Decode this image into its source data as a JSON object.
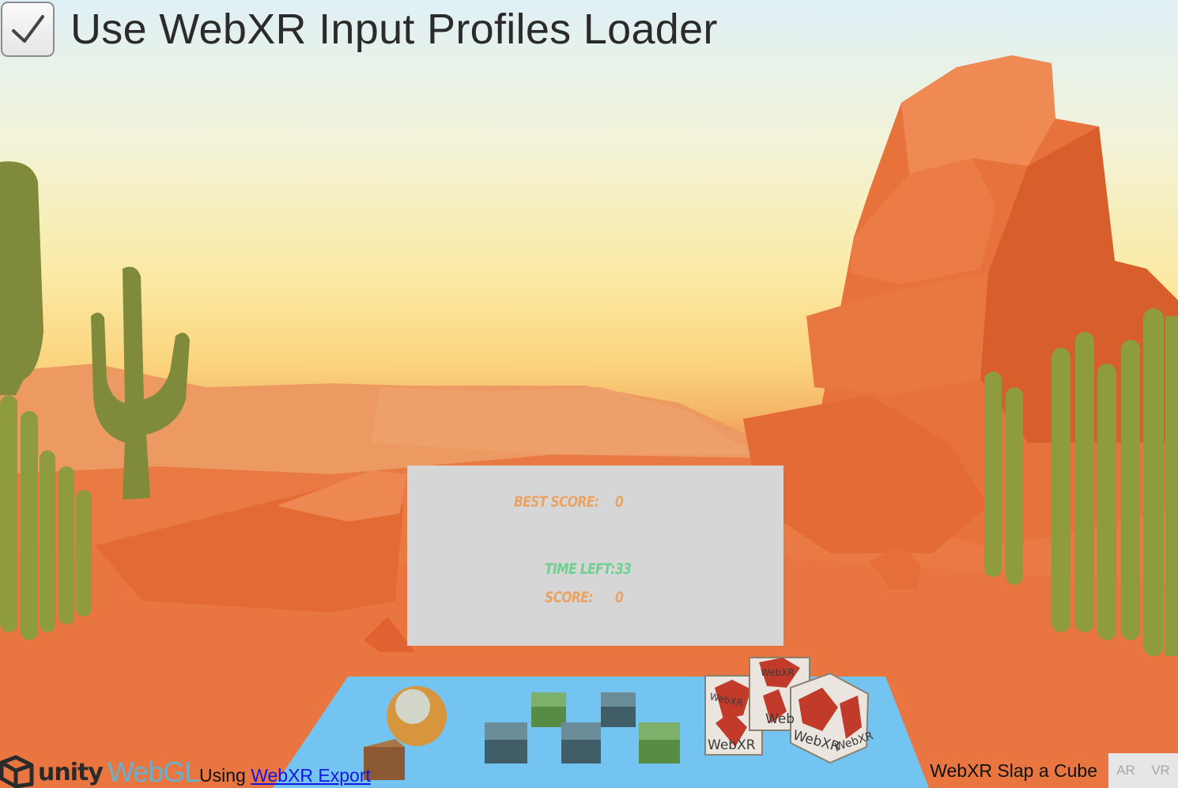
{
  "toggle": {
    "label": "Use WebXR Input Profiles Loader",
    "checked": true,
    "icon": "checkmark-icon"
  },
  "scoreboard": {
    "best_score_label": "BEST SCORE:",
    "best_score_value": "0",
    "time_left_label": "TIME LEFT:",
    "time_left_value": "33",
    "score_label": "SCORE:",
    "score_value": "0"
  },
  "footer": {
    "unity_word": "unity",
    "webgl_word": "WebGL",
    "using_prefix": "Using ",
    "export_link": "WebXR Export",
    "app_title": "WebXR Slap a Cube",
    "ar_button": "AR",
    "vr_button": "VR"
  },
  "scene": {
    "cube_brand": "WebXR"
  },
  "colors": {
    "score_orange": "#e9a463",
    "time_green": "#6fcf8e",
    "table_blue": "#74c4f2",
    "rock": "#e8723b",
    "cactus": "#8a9a3f"
  }
}
